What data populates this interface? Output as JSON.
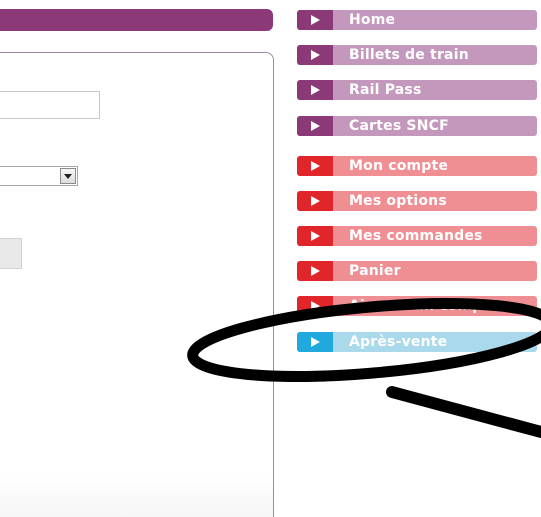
{
  "menu": {
    "items": [
      {
        "label": "Home",
        "color": "#c498bc",
        "accent": "#8b3a77"
      },
      {
        "label": "Billets de train",
        "color": "#c498bc",
        "accent": "#8b3a77"
      },
      {
        "label": "Rail Pass",
        "color": "#c498bc",
        "accent": "#8b3a77"
      },
      {
        "label": "Cartes SNCF",
        "color": "#c498bc",
        "accent": "#8b3a77"
      },
      {
        "label": "Mon compte",
        "color": "#ef8f93",
        "accent": "#e0262b"
      },
      {
        "label": "Mes options",
        "color": "#ef8f93",
        "accent": "#e0262b"
      },
      {
        "label": "Mes commandes",
        "color": "#ef8f93",
        "accent": "#e0262b"
      },
      {
        "label": "Panier",
        "color": "#ef8f93",
        "accent": "#e0262b"
      },
      {
        "label": "Ajouter un compte",
        "color": "#ef8f93",
        "accent": "#e0262b"
      },
      {
        "label": "Après-vente",
        "color": "#a9d9eb",
        "accent": "#21a8dc"
      }
    ]
  },
  "form": {
    "text_value": "",
    "select_value": ""
  },
  "colors": {
    "brand_purple": "#8b3a77",
    "brand_red": "#e0262b",
    "brand_blue": "#21a8dc",
    "annotation": "#000000"
  },
  "icons": {
    "menu_arrow": "play-arrow-icon",
    "select_arrow": "chevron-down-icon"
  }
}
